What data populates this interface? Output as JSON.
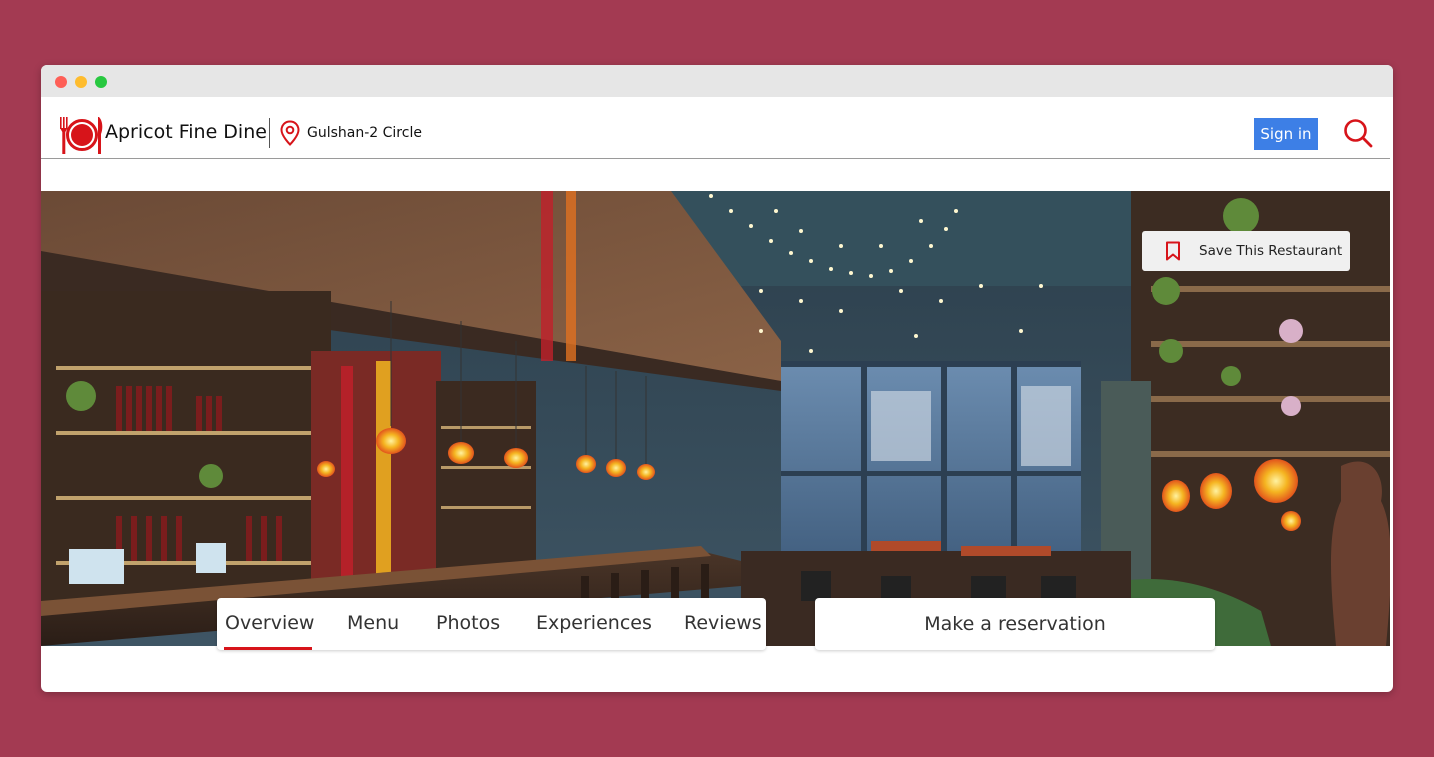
{
  "header": {
    "brand_name": "Apricot Fine Dine",
    "location": "Gulshan-2 Circle",
    "signin_label": "Sign in"
  },
  "hero": {
    "save_label": "Save This Restaurant"
  },
  "tabs": [
    {
      "label": "Overview",
      "active": true
    },
    {
      "label": "Menu",
      "active": false
    },
    {
      "label": "Photos",
      "active": false
    },
    {
      "label": "Experiences",
      "active": false
    },
    {
      "label": "Reviews",
      "active": false
    }
  ],
  "reservation": {
    "label": "Make a reservation"
  },
  "colors": {
    "page_background": "#a33a52",
    "brand_red": "#d7141a",
    "signin_blue": "#3d7fe6"
  },
  "icons": {
    "logo": "plate-fork-knife-icon",
    "location": "map-pin-icon",
    "search": "search-icon",
    "save": "bookmark-icon"
  }
}
